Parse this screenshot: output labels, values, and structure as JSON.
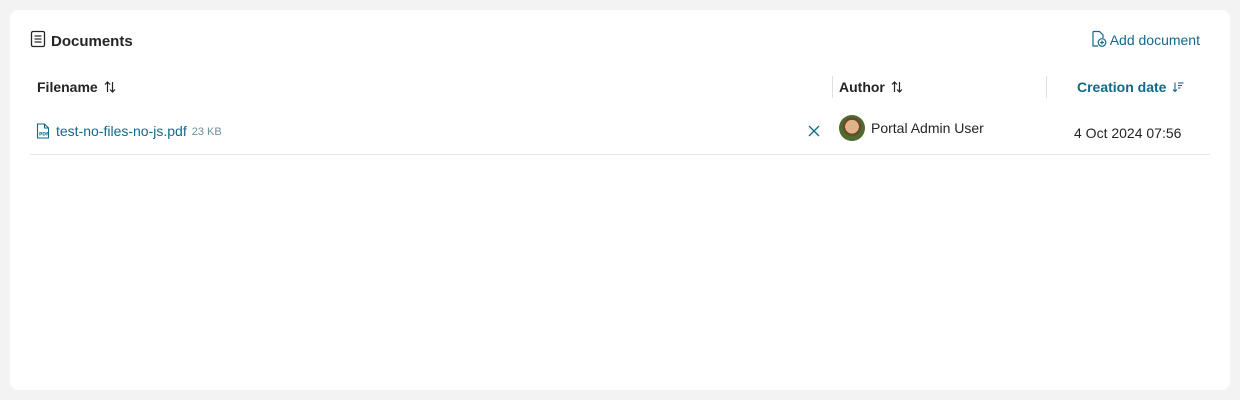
{
  "header": {
    "title": "Documents",
    "title_icon": "document-list-icon",
    "add_label": "Add document",
    "add_icon": "add-document-icon"
  },
  "table": {
    "columns": [
      {
        "label": "Filename",
        "sort_icon": "sort-arrows-icon"
      },
      {
        "label": "Author",
        "sort_icon": "sort-arrows-icon"
      },
      {
        "label": "Creation date",
        "sort_icon": "sort-descending-icon",
        "active": true
      }
    ],
    "rows": [
      {
        "filename": "test-no-files-no-js.pdf",
        "size": "23 KB",
        "file_icon": "pdf-file-icon",
        "remove_icon": "close-icon",
        "author": "Portal Admin User",
        "created": "4 Oct 2024 07:56"
      }
    ]
  },
  "colors": {
    "accent": "#11698a",
    "background": "#f3f3f3",
    "card": "#ffffff"
  }
}
